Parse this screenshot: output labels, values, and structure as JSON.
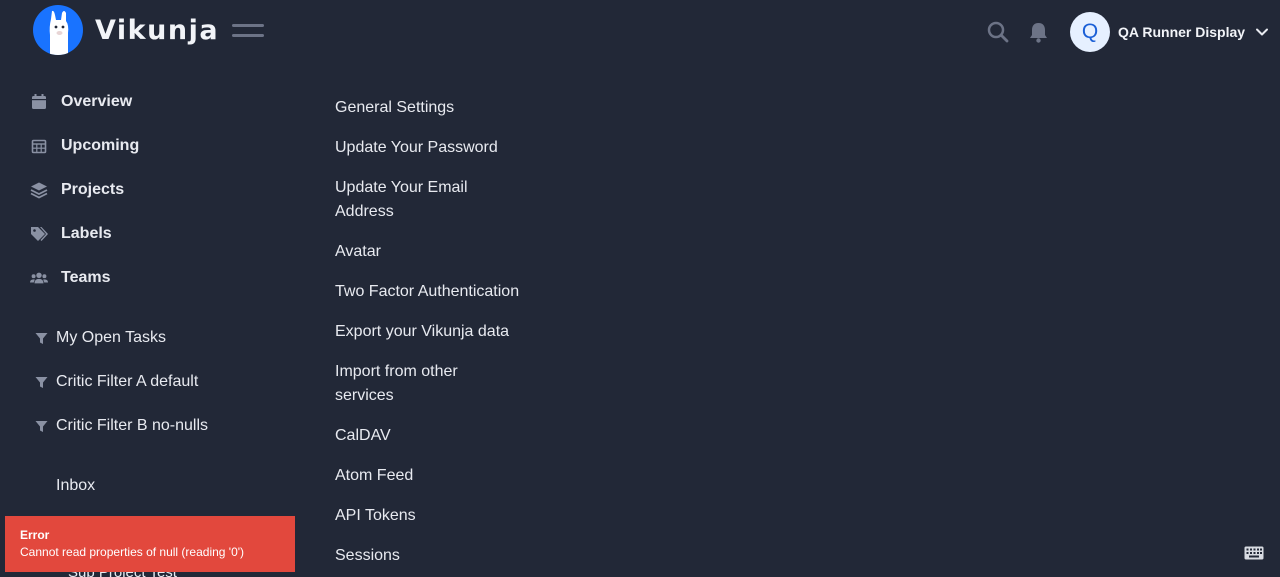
{
  "app": {
    "name": "Vikunja"
  },
  "header": {
    "user": {
      "initial": "Q",
      "name": "QA Runner Display"
    }
  },
  "sidebar": {
    "nav": [
      {
        "label": "Overview",
        "icon": "calendar-icon"
      },
      {
        "label": "Upcoming",
        "icon": "calendar-grid-icon"
      },
      {
        "label": "Projects",
        "icon": "layers-icon"
      },
      {
        "label": "Labels",
        "icon": "tags-icon"
      },
      {
        "label": "Teams",
        "icon": "users-icon"
      }
    ],
    "filters": [
      {
        "label": "My Open Tasks",
        "icon": "filter-icon"
      },
      {
        "label": "Critic Filter A default",
        "icon": "filter-icon"
      },
      {
        "label": "Critic Filter B no-nulls",
        "icon": "filter-icon"
      }
    ],
    "projects": [
      {
        "label": "Inbox"
      }
    ],
    "subprojects": [
      {
        "label": "Sub Project Test"
      }
    ]
  },
  "settings_nav": [
    {
      "label": "General Settings"
    },
    {
      "label": "Update Your Password"
    },
    {
      "label": "Update Your Email Address"
    },
    {
      "label": "Avatar"
    },
    {
      "label": "Two Factor Authentication"
    },
    {
      "label": "Export your Vikunja data"
    },
    {
      "label": "Import from other services"
    },
    {
      "label": "CalDAV"
    },
    {
      "label": "Atom Feed"
    },
    {
      "label": "API Tokens"
    },
    {
      "label": "Sessions"
    }
  ],
  "toast": {
    "title": "Error",
    "message": "Cannot read properties of null (reading '0')",
    "color": "#e2483d"
  },
  "colors": {
    "background": "#222837",
    "brand": "#1973ff",
    "icon_muted": "#8a91a3"
  }
}
